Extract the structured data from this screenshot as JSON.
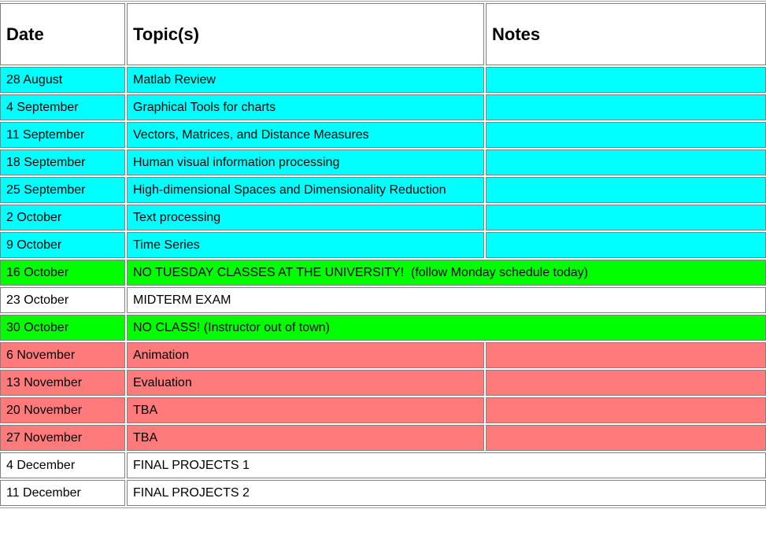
{
  "headers": {
    "date": "Date",
    "topic": "Topic(s)",
    "notes": "Notes"
  },
  "colors": {
    "cyan": "#00ffff",
    "green": "#00ff00",
    "white": "#ffffff",
    "red": "#ff7b7b"
  },
  "rows": [
    {
      "date": "28 August",
      "topic": "Matlab Review",
      "notes": ""
    },
    {
      "date": "4 September",
      "topic": "Graphical Tools for charts",
      "notes": ""
    },
    {
      "date": "11 September",
      "topic": "Vectors, Matrices, and Distance Measures",
      "notes": ""
    },
    {
      "date": "18 September",
      "topic": "Human visual information processing",
      "notes": ""
    },
    {
      "date": "25 September",
      "topic": "High-dimensional Spaces and Dimensionality Reduction",
      "notes": ""
    },
    {
      "date": "2 October",
      "topic": "Text processing",
      "notes": ""
    },
    {
      "date": "9 October",
      "topic": "Time Series",
      "notes": ""
    },
    {
      "date": "16 October",
      "topic": "NO TUESDAY CLASSES AT THE UNIVERSITY!  (follow Monday schedule today)"
    },
    {
      "date": "23 October",
      "topic": "MIDTERM EXAM"
    },
    {
      "date": "30 October",
      "topic": "NO CLASS! (Instructor out of town)"
    },
    {
      "date": "6 November",
      "topic": "Animation",
      "notes": ""
    },
    {
      "date": "13 November",
      "topic": "Evaluation",
      "notes": ""
    },
    {
      "date": "20 November",
      "topic": "TBA",
      "notes": ""
    },
    {
      "date": "27 November",
      "topic": "TBA",
      "notes": ""
    },
    {
      "date": "4 December",
      "topic": "FINAL PROJECTS 1"
    },
    {
      "date": "11 December",
      "topic": "FINAL PROJECTS 2"
    }
  ]
}
